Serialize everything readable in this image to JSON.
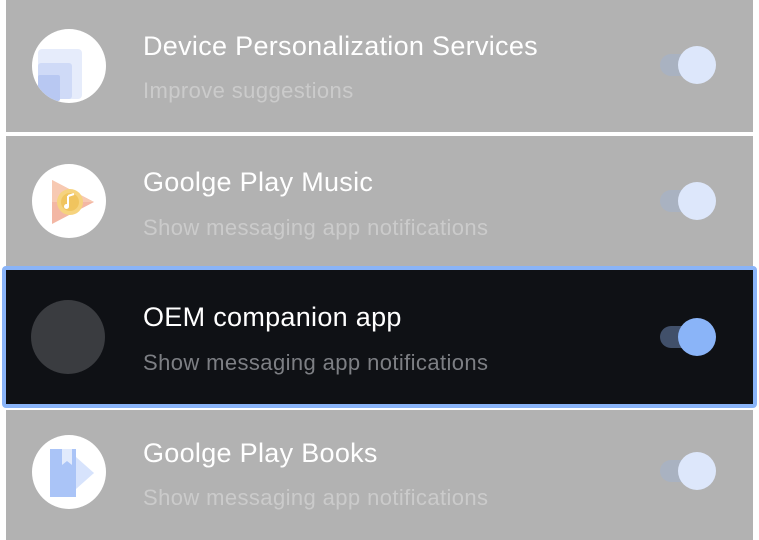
{
  "apps": [
    {
      "title": "Device Personalization Services",
      "subtitle": "Improve suggestions",
      "icon": "device-personalization-icon",
      "enabled": true
    },
    {
      "title": "Goolge Play Music",
      "subtitle": "Show messaging app notifications",
      "icon": "play-music-icon",
      "enabled": true
    },
    {
      "title": "OEM companion app",
      "subtitle": "Show messaging app notifications",
      "icon": "generic-app-icon",
      "enabled": true,
      "focused": true
    },
    {
      "title": "Goolge Play Books",
      "subtitle": "Show messaging app notifications",
      "icon": "play-books-icon",
      "enabled": true
    }
  ],
  "colors": {
    "dimmed_background": "#b2b2b2",
    "focused_background": "#0f1115",
    "focus_border": "#8ab4f8",
    "toggle_on_thumb": "#8ab4f8"
  }
}
